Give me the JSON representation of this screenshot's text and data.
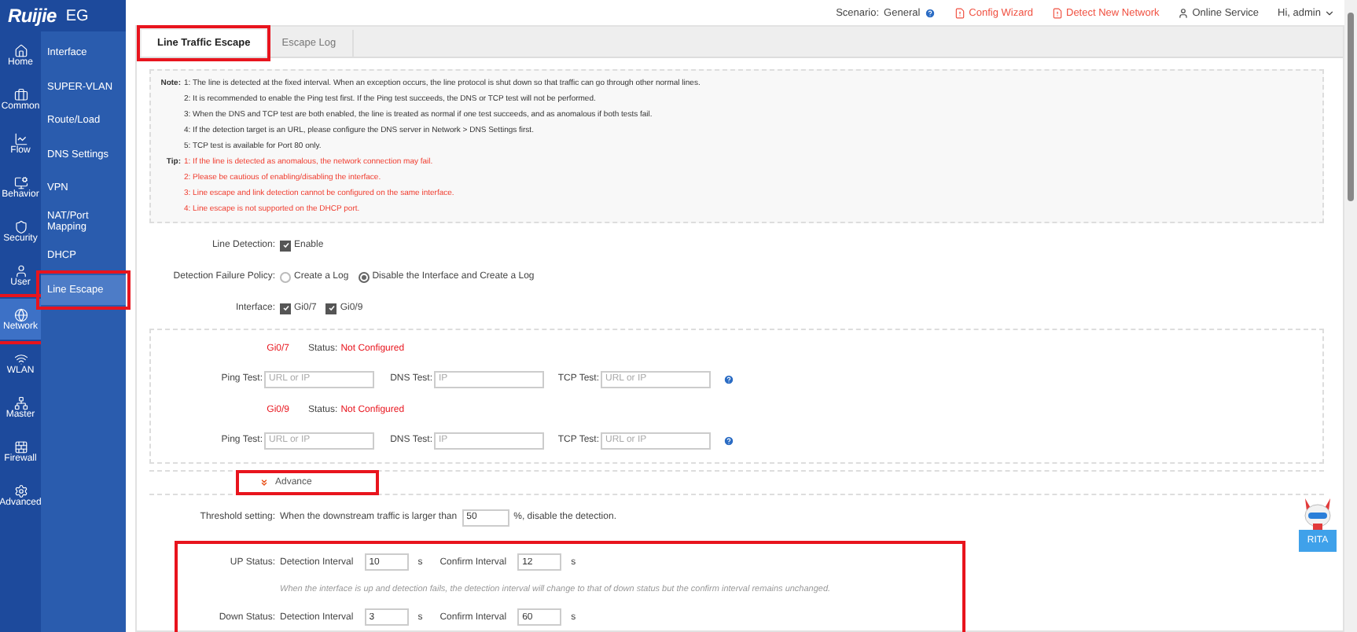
{
  "logo": {
    "brand": "Ruijie",
    "product": "EG"
  },
  "nav_rail": [
    {
      "label": "Home",
      "selected": false,
      "highlighted": false
    },
    {
      "label": "Common",
      "selected": false,
      "highlighted": false
    },
    {
      "label": "Flow",
      "selected": false,
      "highlighted": false
    },
    {
      "label": "Behavior",
      "selected": false,
      "highlighted": false
    },
    {
      "label": "Security",
      "selected": false,
      "highlighted": false
    },
    {
      "label": "User",
      "selected": false,
      "highlighted": false
    },
    {
      "label": "Network",
      "selected": true,
      "highlighted": true
    },
    {
      "label": "WLAN",
      "selected": false,
      "highlighted": false
    },
    {
      "label": "Master",
      "selected": false,
      "highlighted": false
    },
    {
      "label": "Firewall",
      "selected": false,
      "highlighted": false
    },
    {
      "label": "Advanced",
      "selected": false,
      "highlighted": false
    }
  ],
  "submenu": [
    {
      "label": "Interface",
      "selected": false,
      "highlighted": false
    },
    {
      "label": "SUPER-VLAN",
      "selected": false,
      "highlighted": false
    },
    {
      "label": "Route/Load",
      "selected": false,
      "highlighted": false
    },
    {
      "label": "DNS Settings",
      "selected": false,
      "highlighted": false
    },
    {
      "label": "VPN",
      "selected": false,
      "highlighted": false
    },
    {
      "label": "NAT/Port Mapping",
      "selected": false,
      "highlighted": false
    },
    {
      "label": "DHCP",
      "selected": false,
      "highlighted": false
    },
    {
      "label": "Line Escape",
      "selected": true,
      "highlighted": true
    }
  ],
  "header": {
    "scenario_label": "Scenario:",
    "scenario_value": "General",
    "links": [
      {
        "label": "Config Wizard",
        "kind": "alert"
      },
      {
        "label": "Detect New Network",
        "kind": "alert"
      },
      {
        "label": "Online Service",
        "kind": "user"
      }
    ],
    "user": "Hi, admin"
  },
  "tabs": [
    {
      "label": "Line Traffic Escape",
      "selected": true,
      "highlighted": true
    },
    {
      "label": "Escape Log",
      "selected": false,
      "highlighted": false
    }
  ],
  "notes": {
    "label": "Note:",
    "items": [
      "1: The line is detected at the fixed interval. When an exception occurs, the line protocol is shut down so that traffic can go through other normal lines.",
      "2: It is recommended to enable the Ping test first. If the Ping test succeeds, the DNS or TCP test will not be performed.",
      "3: When the DNS and TCP test are both enabled, the line is treated as normal if one test succeeds, and as anomalous if both tests fail.",
      "4: If the detection target is an URL, please configure the DNS server in Network > DNS Settings first.",
      "5: TCP test is available for Port 80 only."
    ]
  },
  "tips": {
    "label": "Tip:",
    "items": [
      "1: If the line is detected as anomalous, the network connection may fail.",
      "2: Please be cautious of enabling/disabling the interface.",
      "3: Line escape and link detection cannot be configured on the same interface.",
      "4: Line escape is not supported on the DHCP port."
    ]
  },
  "line_detection": {
    "label": "Line Detection:",
    "option": "Enable",
    "checked": true
  },
  "failure_policy": {
    "label": "Detection Failure Policy:",
    "options": [
      {
        "label": "Create a Log",
        "selected": false
      },
      {
        "label": "Disable the Interface and Create a Log",
        "selected": true
      }
    ]
  },
  "interface": {
    "label": "Interface:",
    "options": [
      {
        "label": "Gi0/7",
        "checked": true
      },
      {
        "label": "Gi0/9",
        "checked": true
      }
    ]
  },
  "ports": [
    {
      "name": "Gi0/7",
      "status_label": "Status:",
      "status": "Not Configured",
      "tests": [
        {
          "label": "Ping Test:",
          "placeholder": "URL or IP"
        },
        {
          "label": "DNS Test:",
          "placeholder": "IP"
        },
        {
          "label": "TCP Test:",
          "placeholder": "URL or IP"
        }
      ]
    },
    {
      "name": "Gi0/9",
      "status_label": "Status:",
      "status": "Not Configured",
      "tests": [
        {
          "label": "Ping Test:",
          "placeholder": "URL or IP"
        },
        {
          "label": "DNS Test:",
          "placeholder": "IP"
        },
        {
          "label": "TCP Test:",
          "placeholder": "URL or IP"
        }
      ]
    }
  ],
  "advance": {
    "label": "Advance",
    "highlighted": true
  },
  "threshold": {
    "label": "Threshold setting:",
    "prefix": "When the downstream traffic is larger than",
    "value": "50",
    "suffix": "%, disable the detection."
  },
  "status_section": {
    "highlighted": true,
    "rows": [
      {
        "label": "UP Status:",
        "detection_label": "Detection Interval",
        "detection_value": "10",
        "detection_unit": "s",
        "confirm_label": "Confirm Interval",
        "confirm_value": "12",
        "confirm_unit": "s"
      },
      {
        "label": "Down Status:",
        "detection_label": "Detection Interval",
        "detection_value": "3",
        "detection_unit": "s",
        "confirm_label": "Confirm Interval",
        "confirm_value": "60",
        "confirm_unit": "s"
      }
    ],
    "hint": "When the interface is up and detection fails, the detection interval will change to that of down status but the confirm interval remains unchanged."
  },
  "assistant": {
    "label": "RITA"
  }
}
